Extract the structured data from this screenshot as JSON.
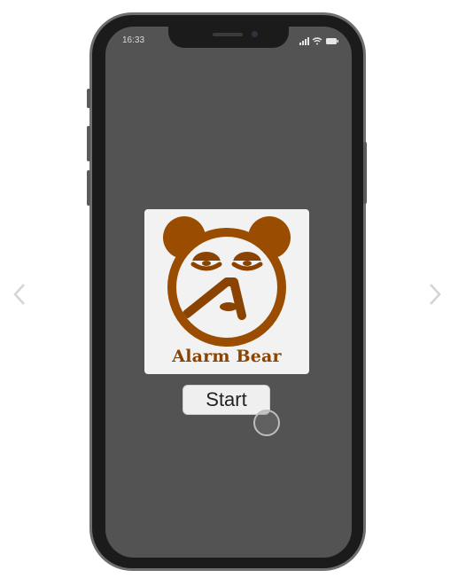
{
  "status_bar": {
    "time": "16:33",
    "icons": [
      "signal-icon",
      "wifi-icon",
      "battery-icon"
    ]
  },
  "logo": {
    "title": "Alarm Bear",
    "color": "#8a4300"
  },
  "start_button": {
    "label": "Start"
  },
  "navigation": {
    "prev_icon": "chevron-left-icon",
    "next_icon": "chevron-right-icon"
  },
  "colors": {
    "screen_bg": "#535353",
    "frame": "#1b1b1b",
    "logo_brown": "#8a4300",
    "card_bg": "#f2f2f2"
  }
}
